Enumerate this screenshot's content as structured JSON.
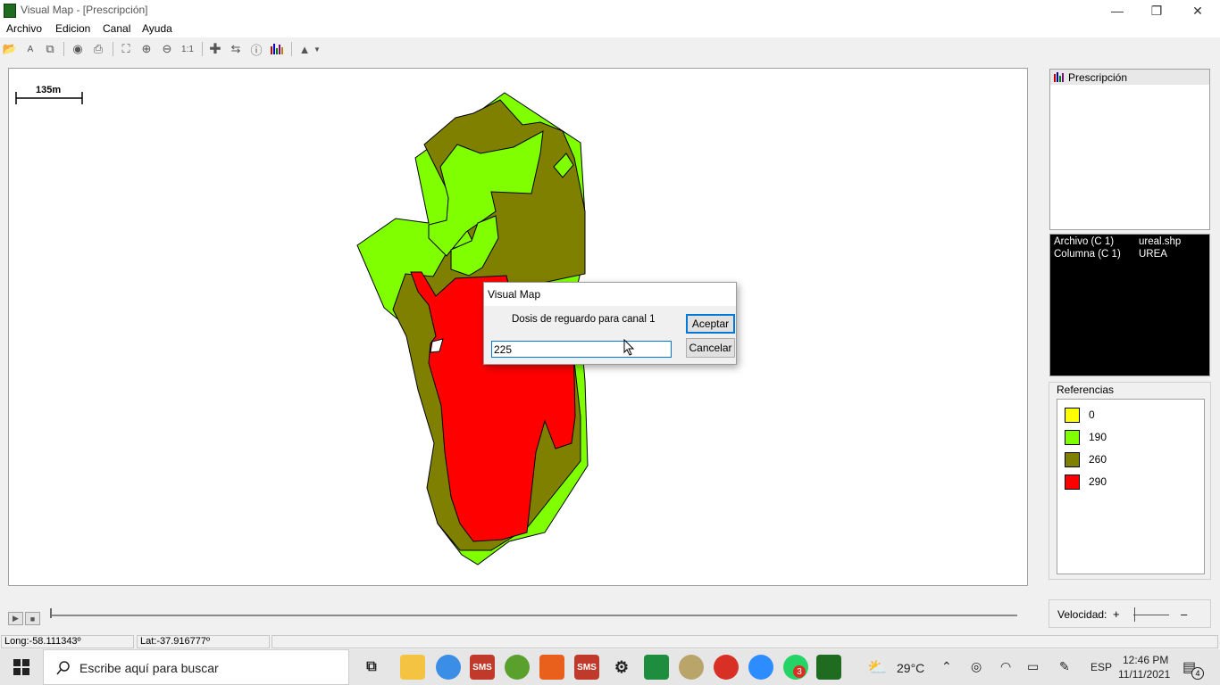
{
  "window": {
    "title": "Visual Map - [Prescripción]",
    "minimize_glyph": "—",
    "restore_glyph": "❐",
    "close_glyph": "✕"
  },
  "menu": [
    "Archivo",
    "Edicion",
    "Canal",
    "Ayuda"
  ],
  "toolbar_icons": [
    "open-folder",
    "label",
    "copy",
    "globe",
    "print",
    "select",
    "zoom-in",
    "zoom-out",
    "zoom-1-1",
    "move",
    "measure",
    "info",
    "chart",
    "text-tool",
    "dropdown"
  ],
  "map": {
    "scale_label": "135m"
  },
  "prescription_panel": {
    "title": "Prescripción"
  },
  "info_panel": {
    "rows": [
      {
        "key": "Archivo (C 1)",
        "value": "ureal.shp"
      },
      {
        "key": "Columna (C 1)",
        "value": "UREA"
      }
    ]
  },
  "references": {
    "title": "Referencias",
    "items": [
      {
        "label": "0",
        "color": "#ffff00"
      },
      {
        "label": "190",
        "color": "#80ff00"
      },
      {
        "label": "260",
        "color": "#808000"
      },
      {
        "label": "290",
        "color": "#ff0000"
      }
    ]
  },
  "playback": {
    "play_glyph": "▶",
    "stop_glyph": "■"
  },
  "speed": {
    "label": "Velocidad:",
    "plus": "+",
    "minus": "–"
  },
  "status": {
    "longitude": "Long:-58.111343º",
    "latitude": "Lat:-37.916777º"
  },
  "dialog": {
    "title": "Visual Map",
    "prompt": "Dosis de reguardo para canal 1",
    "input_value": "225",
    "accept_label": "Aceptar",
    "cancel_label": "Cancelar"
  },
  "taskbar": {
    "search_placeholder": "Escribe aquí para buscar",
    "weather": "29°C",
    "language": "ESP",
    "time": "12:46 PM",
    "date": "11/11/2021",
    "notification_count": "4",
    "whatsapp_badge": "3",
    "app_sms_label": "SMS"
  }
}
